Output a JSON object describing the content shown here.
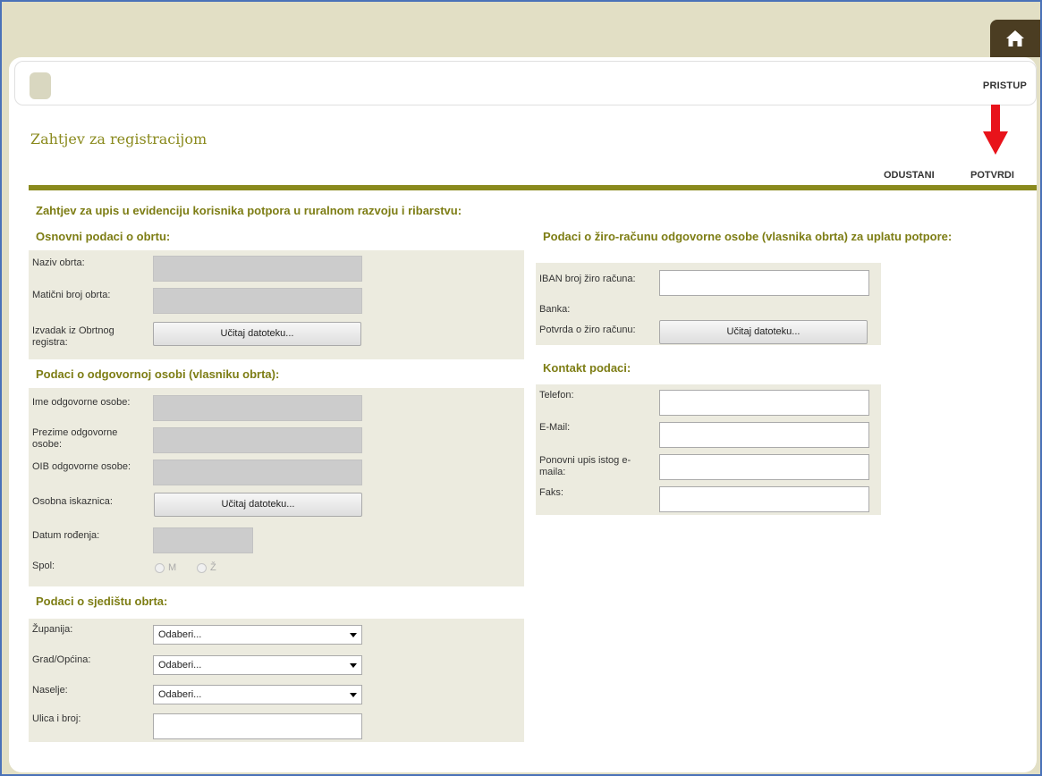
{
  "header": {
    "home_icon": "home-icon",
    "pristup": "PRISTUP"
  },
  "page": {
    "title": "Zahtjev za registracijom",
    "actions": {
      "cancel": "ODUSTANI",
      "confirm": "POTVRDI"
    },
    "annotation_arrow_color": "#e8131b",
    "accent_color": "#8a8a1d"
  },
  "form": {
    "heading": "Zahtjev za upis u evidenciju korisnika potpora u ruralnom razvoju i ribarstvu:",
    "osnovni": {
      "title": "Osnovni podaci o obrtu:",
      "naziv": "Naziv obrta:",
      "maticni": "Matični broj obrta:",
      "izvadak": "Izvadak iz Obrtnog registra:",
      "upload": "Učitaj datoteku..."
    },
    "osoba": {
      "title": "Podaci o odgovornoj osobi (vlasniku obrta):",
      "ime": "Ime odgovorne osobe:",
      "prezime": "Prezime odgovorne osobe:",
      "oib": "OIB odgovorne osobe:",
      "iskaznica": "Osobna iskaznica:",
      "upload": "Učitaj datoteku...",
      "datum": "Datum rođenja:",
      "spol": "Spol:",
      "spol_m": "M",
      "spol_z": "Ž"
    },
    "sjediste": {
      "title": "Podaci o sjedištu obrta:",
      "zupanija": "Županija:",
      "grad": "Grad/Općina:",
      "naselje": "Naselje:",
      "ulica": "Ulica i broj:",
      "select_placeholder": "Odaberi..."
    },
    "racun": {
      "title": "Podaci o žiro-računu odgovorne osobe (vlasnika obrta) za uplatu potpore:",
      "iban": "IBAN broj žiro računa:",
      "banka": "Banka:",
      "potvrda": "Potvrda o žiro računu:",
      "upload": "Učitaj datoteku..."
    },
    "kontakt": {
      "title": "Kontakt podaci:",
      "telefon": "Telefon:",
      "email": "E-Mail:",
      "ponovni": "Ponovni upis istog e-maila:",
      "faks": "Faks:"
    }
  }
}
